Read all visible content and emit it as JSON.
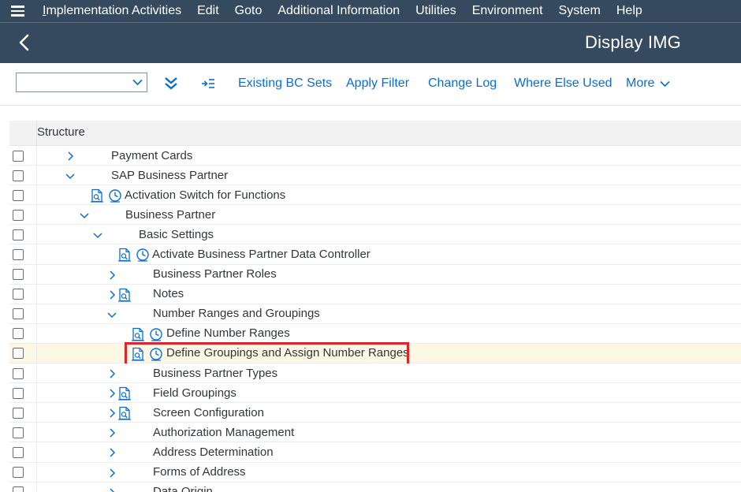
{
  "menu": {
    "items": [
      "Implementation Activities",
      "Edit",
      "Goto",
      "Additional Information",
      "Utilities",
      "Environment",
      "System",
      "Help"
    ]
  },
  "header": {
    "title": "Display IMG"
  },
  "toolbar": {
    "dropdown_value": "",
    "buttons": {
      "existing_bc_sets": "Existing BC Sets",
      "apply_filter": "Apply Filter",
      "change_log": "Change Log",
      "where_else_used": "Where Else Used",
      "more": "More"
    }
  },
  "table": {
    "column_header": "Structure",
    "rows": [
      {
        "label": "Payment Cards",
        "expander": "collapsed",
        "icons": []
      },
      {
        "label": "SAP Business Partner",
        "expander": "expanded",
        "icons": []
      },
      {
        "label": "Activation Switch for Functions",
        "expander": "none",
        "icons": [
          "documentation-icon",
          "execute-clock-icon"
        ]
      },
      {
        "label": "Business Partner",
        "expander": "expanded",
        "icons": []
      },
      {
        "label": "Basic Settings",
        "expander": "expanded",
        "icons": []
      },
      {
        "label": "Activate Business Partner Data Controller",
        "expander": "none",
        "icons": [
          "documentation-icon",
          "execute-clock-icon"
        ]
      },
      {
        "label": "Business Partner Roles",
        "expander": "collapsed",
        "icons": []
      },
      {
        "label": "Notes",
        "expander": "collapsed",
        "icons": [
          "documentation-icon"
        ]
      },
      {
        "label": "Number Ranges and Groupings",
        "expander": "expanded",
        "icons": []
      },
      {
        "label": "Define Number Ranges",
        "expander": "none",
        "icons": [
          "documentation-icon",
          "execute-clock-icon"
        ]
      },
      {
        "label": "Define Groupings and Assign Number Ranges",
        "expander": "none",
        "icons": [
          "documentation-icon",
          "execute-clock-icon"
        ],
        "selected": true,
        "highlighted": true
      },
      {
        "label": "Business Partner Types",
        "expander": "collapsed",
        "icons": []
      },
      {
        "label": "Field Groupings",
        "expander": "collapsed",
        "icons": [
          "documentation-icon"
        ]
      },
      {
        "label": "Screen Configuration",
        "expander": "collapsed",
        "icons": [
          "documentation-icon"
        ]
      },
      {
        "label": "Authorization Management",
        "expander": "collapsed",
        "icons": []
      },
      {
        "label": "Address Determination",
        "expander": "collapsed",
        "icons": []
      },
      {
        "label": "Forms of Address",
        "expander": "collapsed",
        "icons": []
      },
      {
        "label": "Data Origin",
        "expander": "collapsed",
        "icons": []
      }
    ]
  },
  "colors": {
    "shell": "#354a5f",
    "link": "#0a6ed1",
    "highlight_border": "#e0222a",
    "selected_row": "#fcf8e3"
  }
}
